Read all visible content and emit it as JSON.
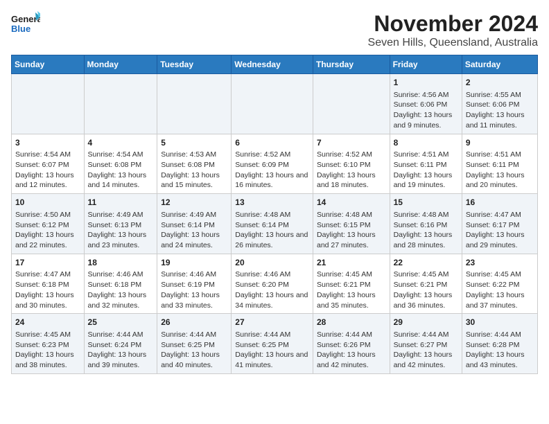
{
  "header": {
    "logo_line1": "General",
    "logo_line2": "Blue",
    "title": "November 2024",
    "subtitle": "Seven Hills, Queensland, Australia"
  },
  "weekdays": [
    "Sunday",
    "Monday",
    "Tuesday",
    "Wednesday",
    "Thursday",
    "Friday",
    "Saturday"
  ],
  "weeks": [
    [
      {
        "day": "",
        "sunrise": "",
        "sunset": "",
        "daylight": ""
      },
      {
        "day": "",
        "sunrise": "",
        "sunset": "",
        "daylight": ""
      },
      {
        "day": "",
        "sunrise": "",
        "sunset": "",
        "daylight": ""
      },
      {
        "day": "",
        "sunrise": "",
        "sunset": "",
        "daylight": ""
      },
      {
        "day": "",
        "sunrise": "",
        "sunset": "",
        "daylight": ""
      },
      {
        "day": "1",
        "sunrise": "Sunrise: 4:56 AM",
        "sunset": "Sunset: 6:06 PM",
        "daylight": "Daylight: 13 hours and 9 minutes."
      },
      {
        "day": "2",
        "sunrise": "Sunrise: 4:55 AM",
        "sunset": "Sunset: 6:06 PM",
        "daylight": "Daylight: 13 hours and 11 minutes."
      }
    ],
    [
      {
        "day": "3",
        "sunrise": "Sunrise: 4:54 AM",
        "sunset": "Sunset: 6:07 PM",
        "daylight": "Daylight: 13 hours and 12 minutes."
      },
      {
        "day": "4",
        "sunrise": "Sunrise: 4:54 AM",
        "sunset": "Sunset: 6:08 PM",
        "daylight": "Daylight: 13 hours and 14 minutes."
      },
      {
        "day": "5",
        "sunrise": "Sunrise: 4:53 AM",
        "sunset": "Sunset: 6:08 PM",
        "daylight": "Daylight: 13 hours and 15 minutes."
      },
      {
        "day": "6",
        "sunrise": "Sunrise: 4:52 AM",
        "sunset": "Sunset: 6:09 PM",
        "daylight": "Daylight: 13 hours and 16 minutes."
      },
      {
        "day": "7",
        "sunrise": "Sunrise: 4:52 AM",
        "sunset": "Sunset: 6:10 PM",
        "daylight": "Daylight: 13 hours and 18 minutes."
      },
      {
        "day": "8",
        "sunrise": "Sunrise: 4:51 AM",
        "sunset": "Sunset: 6:11 PM",
        "daylight": "Daylight: 13 hours and 19 minutes."
      },
      {
        "day": "9",
        "sunrise": "Sunrise: 4:51 AM",
        "sunset": "Sunset: 6:11 PM",
        "daylight": "Daylight: 13 hours and 20 minutes."
      }
    ],
    [
      {
        "day": "10",
        "sunrise": "Sunrise: 4:50 AM",
        "sunset": "Sunset: 6:12 PM",
        "daylight": "Daylight: 13 hours and 22 minutes."
      },
      {
        "day": "11",
        "sunrise": "Sunrise: 4:49 AM",
        "sunset": "Sunset: 6:13 PM",
        "daylight": "Daylight: 13 hours and 23 minutes."
      },
      {
        "day": "12",
        "sunrise": "Sunrise: 4:49 AM",
        "sunset": "Sunset: 6:14 PM",
        "daylight": "Daylight: 13 hours and 24 minutes."
      },
      {
        "day": "13",
        "sunrise": "Sunrise: 4:48 AM",
        "sunset": "Sunset: 6:14 PM",
        "daylight": "Daylight: 13 hours and 26 minutes."
      },
      {
        "day": "14",
        "sunrise": "Sunrise: 4:48 AM",
        "sunset": "Sunset: 6:15 PM",
        "daylight": "Daylight: 13 hours and 27 minutes."
      },
      {
        "day": "15",
        "sunrise": "Sunrise: 4:48 AM",
        "sunset": "Sunset: 6:16 PM",
        "daylight": "Daylight: 13 hours and 28 minutes."
      },
      {
        "day": "16",
        "sunrise": "Sunrise: 4:47 AM",
        "sunset": "Sunset: 6:17 PM",
        "daylight": "Daylight: 13 hours and 29 minutes."
      }
    ],
    [
      {
        "day": "17",
        "sunrise": "Sunrise: 4:47 AM",
        "sunset": "Sunset: 6:18 PM",
        "daylight": "Daylight: 13 hours and 30 minutes."
      },
      {
        "day": "18",
        "sunrise": "Sunrise: 4:46 AM",
        "sunset": "Sunset: 6:18 PM",
        "daylight": "Daylight: 13 hours and 32 minutes."
      },
      {
        "day": "19",
        "sunrise": "Sunrise: 4:46 AM",
        "sunset": "Sunset: 6:19 PM",
        "daylight": "Daylight: 13 hours and 33 minutes."
      },
      {
        "day": "20",
        "sunrise": "Sunrise: 4:46 AM",
        "sunset": "Sunset: 6:20 PM",
        "daylight": "Daylight: 13 hours and 34 minutes."
      },
      {
        "day": "21",
        "sunrise": "Sunrise: 4:45 AM",
        "sunset": "Sunset: 6:21 PM",
        "daylight": "Daylight: 13 hours and 35 minutes."
      },
      {
        "day": "22",
        "sunrise": "Sunrise: 4:45 AM",
        "sunset": "Sunset: 6:21 PM",
        "daylight": "Daylight: 13 hours and 36 minutes."
      },
      {
        "day": "23",
        "sunrise": "Sunrise: 4:45 AM",
        "sunset": "Sunset: 6:22 PM",
        "daylight": "Daylight: 13 hours and 37 minutes."
      }
    ],
    [
      {
        "day": "24",
        "sunrise": "Sunrise: 4:45 AM",
        "sunset": "Sunset: 6:23 PM",
        "daylight": "Daylight: 13 hours and 38 minutes."
      },
      {
        "day": "25",
        "sunrise": "Sunrise: 4:44 AM",
        "sunset": "Sunset: 6:24 PM",
        "daylight": "Daylight: 13 hours and 39 minutes."
      },
      {
        "day": "26",
        "sunrise": "Sunrise: 4:44 AM",
        "sunset": "Sunset: 6:25 PM",
        "daylight": "Daylight: 13 hours and 40 minutes."
      },
      {
        "day": "27",
        "sunrise": "Sunrise: 4:44 AM",
        "sunset": "Sunset: 6:25 PM",
        "daylight": "Daylight: 13 hours and 41 minutes."
      },
      {
        "day": "28",
        "sunrise": "Sunrise: 4:44 AM",
        "sunset": "Sunset: 6:26 PM",
        "daylight": "Daylight: 13 hours and 42 minutes."
      },
      {
        "day": "29",
        "sunrise": "Sunrise: 4:44 AM",
        "sunset": "Sunset: 6:27 PM",
        "daylight": "Daylight: 13 hours and 42 minutes."
      },
      {
        "day": "30",
        "sunrise": "Sunrise: 4:44 AM",
        "sunset": "Sunset: 6:28 PM",
        "daylight": "Daylight: 13 hours and 43 minutes."
      }
    ]
  ]
}
